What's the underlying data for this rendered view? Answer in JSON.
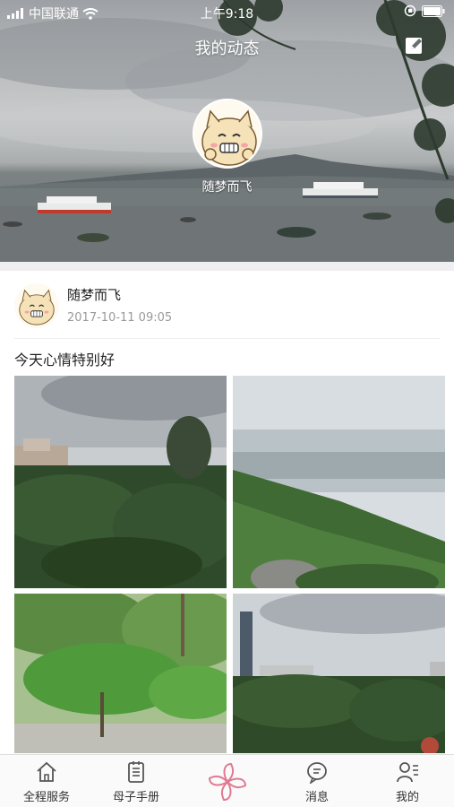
{
  "status_bar": {
    "carrier": "中国联通",
    "time": "上午9:18"
  },
  "header": {
    "title": "我的动态",
    "edit_icon": "edit-icon"
  },
  "profile": {
    "name": "随梦而飞"
  },
  "post": {
    "author": "随梦而飞",
    "time": "2017-10-11 09:05",
    "text": "今天心情特别好",
    "photo_count": 4
  },
  "tabbar": {
    "items": [
      {
        "label": "全程服务",
        "icon": "house-icon"
      },
      {
        "label": "母子手册",
        "icon": "notebook-icon"
      },
      {
        "label": "",
        "icon": "pinwheel-icon"
      },
      {
        "label": "消息",
        "icon": "chat-bubble-icon"
      },
      {
        "label": "我的",
        "icon": "person-list-icon"
      }
    ]
  },
  "colors": {
    "accent_pink": "#e07a91",
    "text_primary": "#222222",
    "text_secondary": "#9a9a9a"
  }
}
